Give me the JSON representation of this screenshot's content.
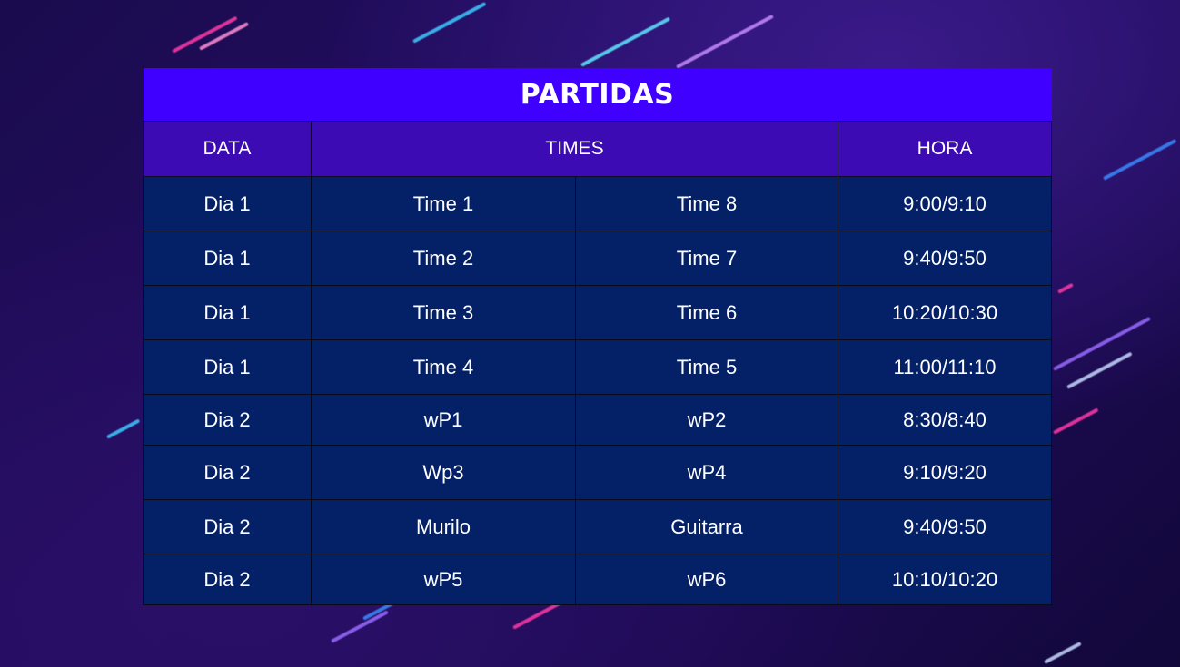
{
  "title": "PARTIDAS",
  "headers": {
    "data": "DATA",
    "times": "TIMES",
    "hora": "HORA"
  },
  "rows": [
    {
      "dia": "Dia 1",
      "time_a": "Time 1",
      "time_b": "Time 8",
      "hora": "9:00/9:10"
    },
    {
      "dia": "Dia 1",
      "time_a": "Time 2",
      "time_b": "Time 7",
      "hora": "9:40/9:50"
    },
    {
      "dia": "Dia 1",
      "time_a": "Time 3",
      "time_b": "Time 6",
      "hora": "10:20/10:30"
    },
    {
      "dia": "Dia 1",
      "time_a": "Time 4",
      "time_b": "Time 5",
      "hora": "11:00/11:10"
    },
    {
      "dia": "Dia 2",
      "time_a": "wP1",
      "time_b": "wP2",
      "hora": "8:30/8:40"
    },
    {
      "dia": "Dia 2",
      "time_a": "Wp3",
      "time_b": "wP4",
      "hora": "9:10/9:20"
    },
    {
      "dia": "Dia 2",
      "time_a": "Murilo",
      "time_b": "Guitarra",
      "hora": "9:40/9:50"
    },
    {
      "dia": "Dia 2",
      "time_a": "wP5",
      "time_b": "wP6",
      "hora": "10:10/10:20"
    }
  ],
  "colors": {
    "title_bg": "#3f00ff",
    "header_bg": "#3c0bb3",
    "cell_bg": "#042066",
    "text": "#ffffff"
  }
}
